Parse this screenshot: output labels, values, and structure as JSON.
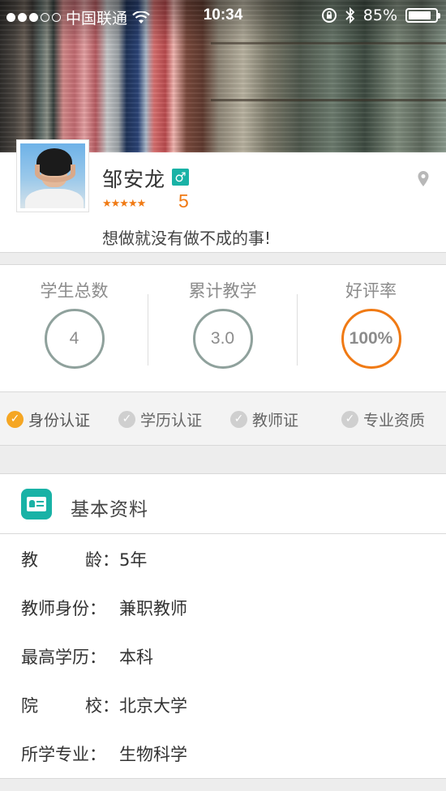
{
  "status_bar": {
    "carrier": "中国联通",
    "time": "10:34",
    "battery": "85%"
  },
  "profile": {
    "name": "邹安龙",
    "gender_symbol": "♂",
    "stars": "★★★★★",
    "rating": "5",
    "motto": "想做就没有做不成的事!"
  },
  "stats": [
    {
      "label": "学生总数",
      "value": "4"
    },
    {
      "label": "累计教学",
      "value": "3.0"
    },
    {
      "label": "好评率",
      "value": "100%"
    }
  ],
  "certifications": [
    {
      "label": "身份认证",
      "verified": true
    },
    {
      "label": "学历认证",
      "verified": false
    },
    {
      "label": "教师证",
      "verified": false
    },
    {
      "label": "专业资质",
      "verified": false
    }
  ],
  "basic_info": {
    "title": "基本资料",
    "rows": [
      {
        "key_a": "教",
        "key_b": "龄：",
        "value": "5年"
      },
      {
        "key_a": "教师身份：",
        "key_b": "",
        "value": "兼职教师"
      },
      {
        "key_a": "最高学历：",
        "key_b": "",
        "value": "本科"
      },
      {
        "key_a": "院",
        "key_b": "校：",
        "value": "北京大学"
      },
      {
        "key_a": "所学专业：",
        "key_b": "",
        "value": "生物科学"
      }
    ]
  },
  "colors": {
    "accent_orange": "#f07a14",
    "teal": "#19b2a6",
    "check_gray": "#cfcfcf",
    "check_on": "#f5a623"
  },
  "icons": [
    "wifi-icon",
    "lock-rotation-icon",
    "bluetooth-icon",
    "battery-icon",
    "location-pin-icon",
    "check-icon",
    "id-card-icon",
    "male-icon",
    "star-icon"
  ]
}
